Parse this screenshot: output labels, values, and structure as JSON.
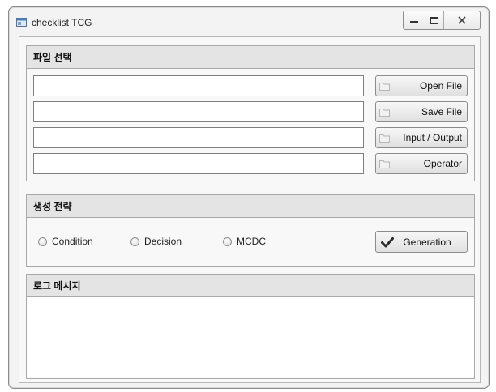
{
  "window": {
    "title": "checklist TCG"
  },
  "file_section": {
    "title": "파일 선택",
    "fields": [
      {
        "value": "",
        "button": "Open File"
      },
      {
        "value": "",
        "button": "Save File"
      },
      {
        "value": "",
        "button": "Input / Output"
      },
      {
        "value": "",
        "button": "Operator"
      }
    ]
  },
  "strategy_section": {
    "title": "생성 전략",
    "options": [
      "Condition",
      "Decision",
      "MCDC"
    ],
    "generate_button": "Generation"
  },
  "log_section": {
    "title": "로그 메시지",
    "content": ""
  },
  "colors": {
    "header_bg": "#e4e4e4",
    "check_icon": "#2a2a2a"
  }
}
